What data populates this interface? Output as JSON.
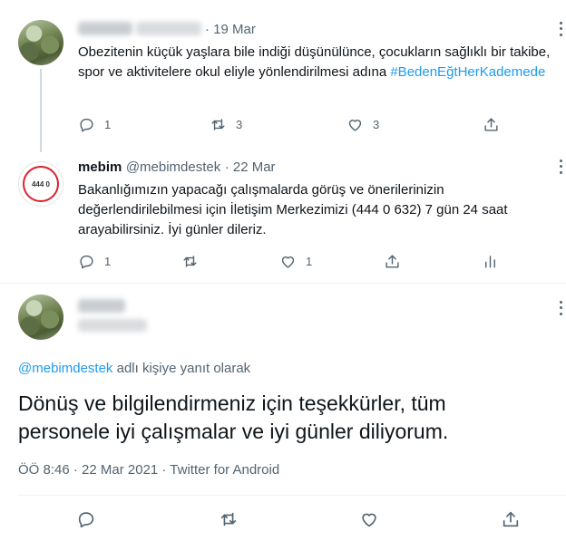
{
  "tweet1": {
    "date": "· 19 Mar",
    "text": "Obezitenin küçük yaşlara bile indiği düşünülünce, çocukların sağlıklı bir takibe, spor ve aktivitelere okul eliyle yönlendirilmesi adına",
    "hashtag": "#BedenEğtHerKademede",
    "reply_count": "1",
    "retweet_count": "3",
    "like_count": "3"
  },
  "tweet2": {
    "name": "mebim",
    "handle": "@mebimdestek",
    "date": "· 22 Mar",
    "avatar_text": "444 0",
    "text": "Bakanlığımızın yapacağı çalışmalarda görüş ve önerilerinizin değerlendirilebilmesi için İletişim Merkezimizi (444 0 632) 7 gün 24 saat arayabilirsiniz. İyi günler dileriz.",
    "reply_count": "1",
    "like_count": "1"
  },
  "main_tweet": {
    "reply_to_handle": "@mebimdestek",
    "reply_to_suffix": "adlı kişiye yanıt olarak",
    "text": "Dönüş ve bilgilendirmeniz için teşekkürler, tüm personele iyi çalışmalar ve iyi günler diliyorum.",
    "meta": "ÖÖ 8:46 · 22 Mar 2021 · Twitter for Android"
  },
  "icons": [
    "reply-icon",
    "retweet-icon",
    "like-icon",
    "share-icon",
    "analytics-icon",
    "more-icon"
  ],
  "colors": {
    "link": "#1d9bf0",
    "muted": "#536471",
    "text": "#0f1419",
    "thread_line": "#cfd9de"
  }
}
